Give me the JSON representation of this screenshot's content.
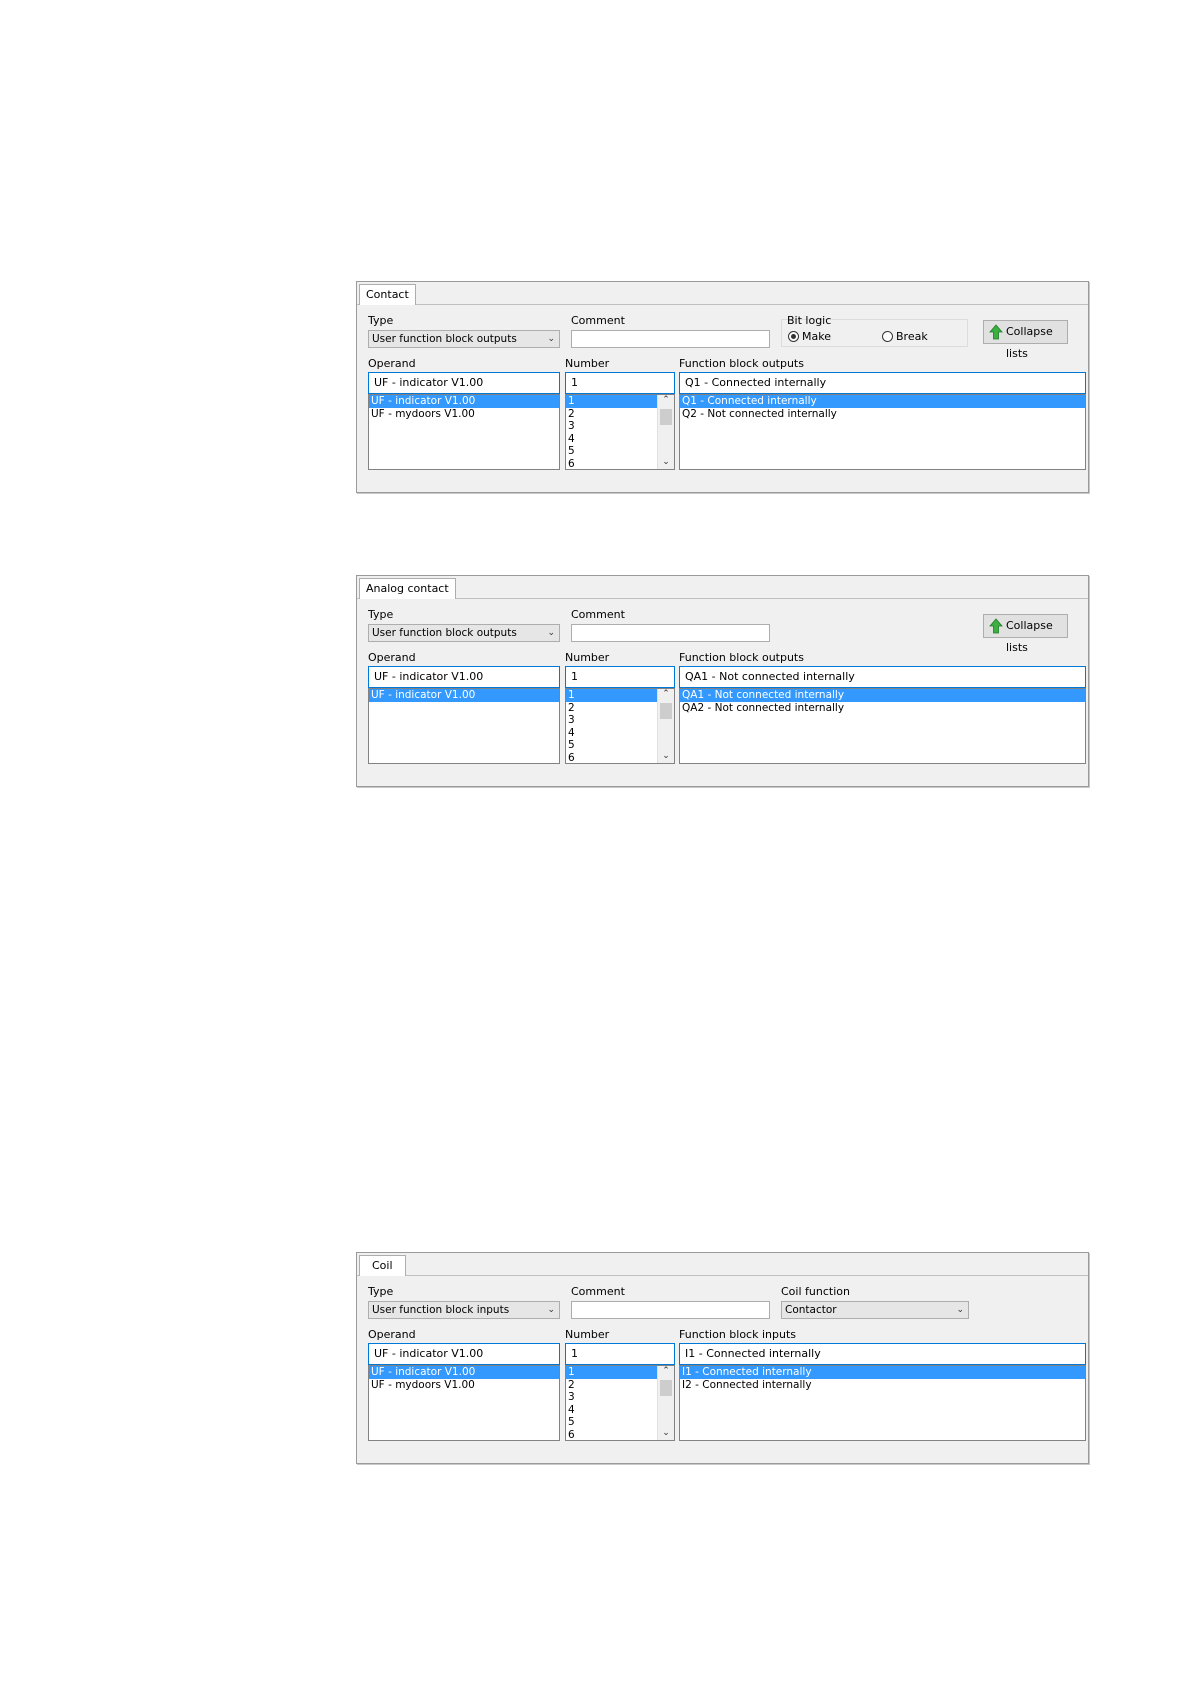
{
  "panels": [
    {
      "tab": "Contact",
      "type_label": "Type",
      "type_value": "User function block outputs",
      "comment_label": "Comment",
      "bitlogic_label": "Bit logic",
      "make_label": "Make",
      "break_label": "Break",
      "collapse_label": "Collapse lists",
      "operand_label": "Operand",
      "operand_value": "UF - indicator V1.00",
      "operand_items": [
        "UF - indicator V1.00",
        "UF - mydoors V1.00"
      ],
      "number_label": "Number",
      "number_value": "1",
      "number_items": [
        "1",
        "2",
        "3",
        "4",
        "5",
        "6"
      ],
      "fb_label": "Function block outputs",
      "fb_value": "Q1 - Connected internally",
      "fb_items": [
        "Q1 - Connected internally",
        "Q2 - Not connected internally"
      ]
    },
    {
      "tab": "Analog contact",
      "type_label": "Type",
      "type_value": "User function block outputs",
      "comment_label": "Comment",
      "collapse_label": "Collapse lists",
      "operand_label": "Operand",
      "operand_value": "UF - indicator V1.00",
      "operand_items": [
        "UF - indicator V1.00"
      ],
      "number_label": "Number",
      "number_value": "1",
      "number_items": [
        "1",
        "2",
        "3",
        "4",
        "5",
        "6"
      ],
      "fb_label": "Function block outputs",
      "fb_value": "QA1 - Not connected internally",
      "fb_items": [
        "QA1 - Not connected internally",
        "QA2 - Not connected internally"
      ]
    },
    {
      "tab": "Coil",
      "type_label": "Type",
      "type_value": "User function block inputs",
      "comment_label": "Comment",
      "coilfn_label": "Coil function",
      "coilfn_value": "Contactor",
      "operand_label": "Operand",
      "operand_value": "UF - indicator V1.00",
      "operand_items": [
        "UF - indicator V1.00",
        "UF - mydoors V1.00"
      ],
      "number_label": "Number",
      "number_value": "1",
      "number_items": [
        "1",
        "2",
        "3",
        "4",
        "5",
        "6"
      ],
      "fb_label": "Function block inputs",
      "fb_value": "I1 - Connected internally",
      "fb_items": [
        "I1 - Connected internally",
        "I2 - Connected internally"
      ]
    }
  ],
  "icons": {
    "collapse": "green-up-arrow-icon",
    "dropdown": "chevron-down-icon",
    "scroll_up": "chevron-up-icon",
    "scroll_down": "chevron-down-icon"
  },
  "colors": {
    "selection": "#3399ff",
    "focus_border": "#0078d7",
    "arrow_green": "#3cb043"
  }
}
